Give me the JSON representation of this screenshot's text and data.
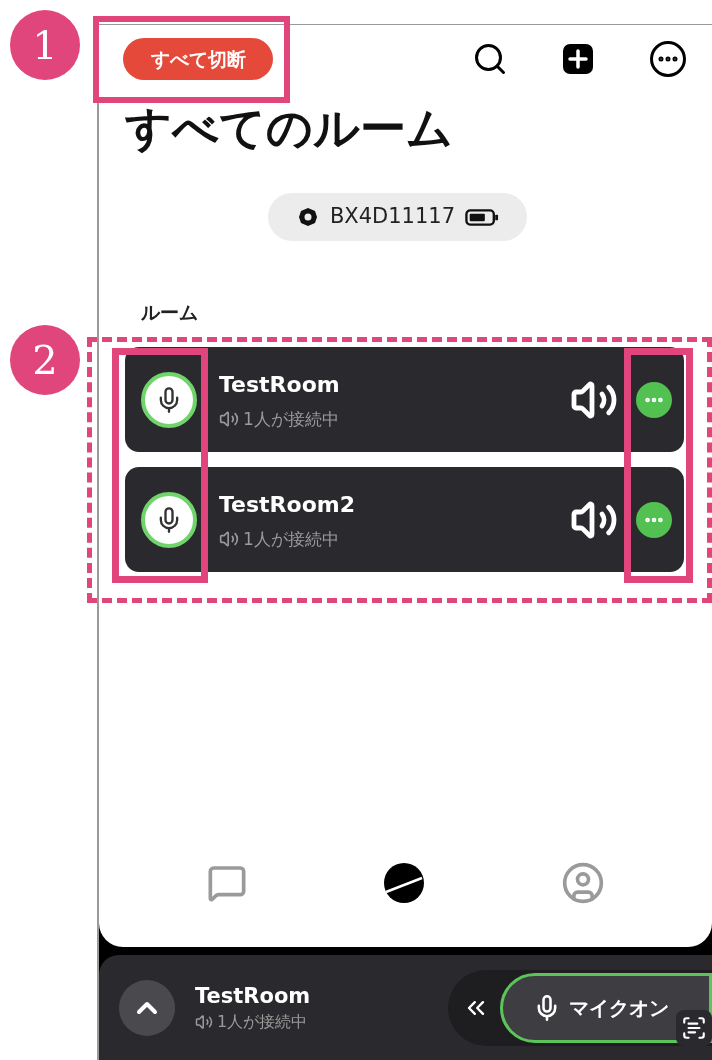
{
  "annotations": [
    {
      "number": "1"
    },
    {
      "number": "2"
    }
  ],
  "header": {
    "disconnect_all_button": "すべて切断"
  },
  "title": "すべてのルーム",
  "device": {
    "name": "BX4D11117"
  },
  "section_label": "ルーム",
  "rooms": [
    {
      "name": "TestRoom",
      "status": "1人が接続中"
    },
    {
      "name": "TestRoom2",
      "status": "1人が接続中"
    }
  ],
  "tab_bar": {
    "tabs": [
      {
        "kind": "chat",
        "selected": false
      },
      {
        "kind": "rooms",
        "selected": true
      },
      {
        "kind": "profile",
        "selected": false
      }
    ]
  },
  "mini_player": {
    "room": "TestRoom",
    "status": "1人が接続中",
    "mic_button": "マイクオン"
  }
}
